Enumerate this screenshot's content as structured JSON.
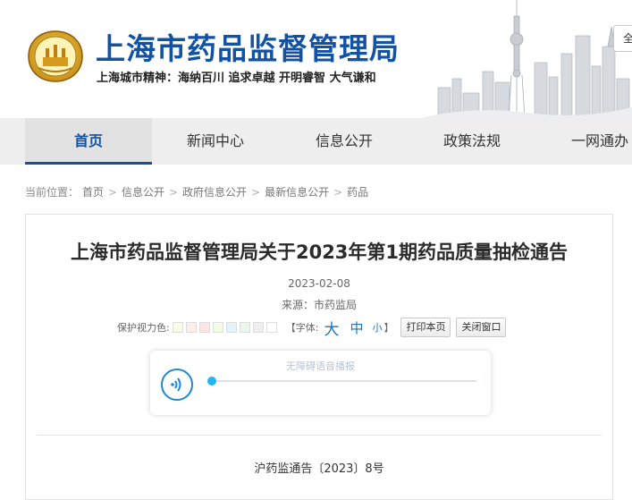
{
  "header": {
    "site_title": "上海市药品监督管理局",
    "motto": "上海城市精神：海纳百川  追求卓越  开明睿智  大气谦和",
    "lang_label": "全"
  },
  "nav": {
    "items": [
      {
        "label": "首页",
        "active": true
      },
      {
        "label": "新闻中心"
      },
      {
        "label": "信息公开"
      },
      {
        "label": "政策法规"
      },
      {
        "label": "一网通办"
      }
    ]
  },
  "breadcrumb": {
    "prefix": "当前位置",
    "colon": "：",
    "sep": ">",
    "items": [
      "首页",
      "信息公开",
      "政府信息公开",
      "最新信息公开",
      "药品"
    ]
  },
  "article": {
    "title": "上海市药品监督管理局关于2023年第1期药品质量抽检通告",
    "date": "2023-02-08",
    "source": "来源：市药监局",
    "tools": {
      "color_label": "保护视力色:",
      "swatches": [
        "#fafbe7",
        "#fbefe8",
        "#fbe6e4",
        "#f3fae7",
        "#e3f3fb",
        "#eaf7ec",
        "#eeeeee",
        "#ffffff"
      ],
      "font_label": "【字体:",
      "font_big": "大",
      "font_mid": "中",
      "font_small": "小",
      "font_end": "】",
      "print_label": "打印本页",
      "close_label": "关闭窗口"
    },
    "player": {
      "title": "无障碍语音播报",
      "progress": 0,
      "accent": "#1e88d8"
    },
    "doc_number": "沪药监通告〔2023〕8号"
  },
  "colors": {
    "brand": "#1351a3",
    "nav_bg": "#eeeeee"
  }
}
